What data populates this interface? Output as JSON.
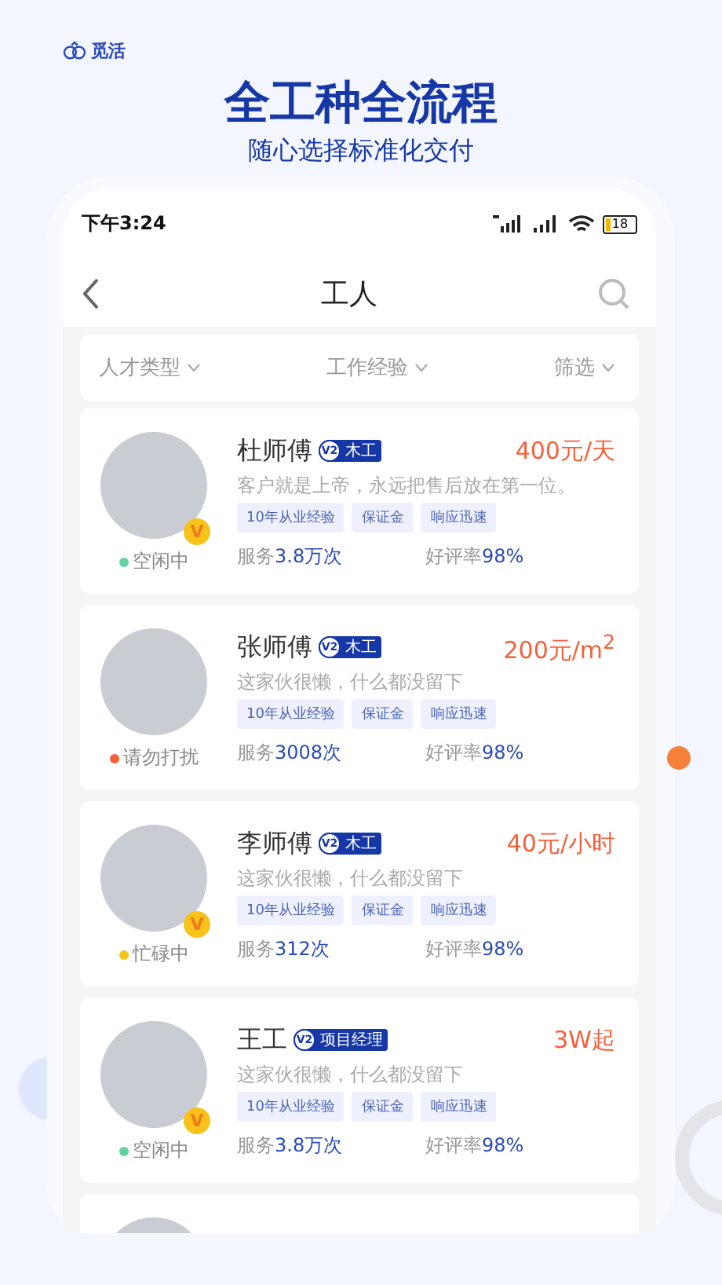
{
  "brand": {
    "name": "觅活"
  },
  "headline": "全工种全流程",
  "subheadline": "随心选择标准化交付",
  "status_bar": {
    "time": "下午3:24",
    "battery": "18"
  },
  "nav": {
    "title": "工人"
  },
  "filters": [
    {
      "label": "人才类型"
    },
    {
      "label": "工作经验"
    },
    {
      "label": "筛选"
    }
  ],
  "workers": [
    {
      "name": "杜师傅",
      "level": "V2",
      "trade": "木工",
      "price": "400元/天",
      "motto": "客户就是上帝，永远把售后放在第一位。",
      "tags": [
        "10年从业经验",
        "保证金",
        "响应迅速"
      ],
      "service_label": "服务",
      "service_value": "3.8万次",
      "rating_label": "好评率",
      "rating_value": "98%",
      "status": "空闲中",
      "color": "#5fd3a0",
      "badge": "V"
    },
    {
      "name": "张师傅",
      "level": "V2",
      "trade": "木工",
      "price": "200元/m$^{2}$",
      "motto": "这家伙很懒，什么都没留下",
      "tags": [
        "10年从业经验",
        "保证金",
        "响应迅速"
      ],
      "service_label": "服务",
      "service_value": "3008次",
      "rating_label": "好评率",
      "rating_value": "98%",
      "status": "请勿打扰",
      "color": "#f5603a"
    },
    {
      "name": "李师傅",
      "level": "V2",
      "trade": "木工",
      "price": "40元/小时",
      "motto": "这家伙很懒，什么都没留下",
      "tags": [
        "10年从业经验",
        "保证金",
        "响应迅速"
      ],
      "service_label": "服务",
      "service_value": "312次",
      "rating_label": "好评率",
      "rating_value": "98%",
      "status": "忙碌中",
      "color": "#f5c518",
      "badge": "V"
    },
    {
      "name": "王工",
      "level": "V2",
      "trade": "项目经理",
      "price": "3W起",
      "motto": "这家伙很懒，什么都没留下",
      "tags": [
        "10年从业经验",
        "保证金",
        "响应迅速"
      ],
      "service_label": "服务",
      "service_value": "3.8万次",
      "rating_label": "好评率",
      "rating_value": "98%",
      "status": "空闲中",
      "color": "#5fd3a0",
      "badge": "V"
    }
  ],
  "next_card_peek": true
}
